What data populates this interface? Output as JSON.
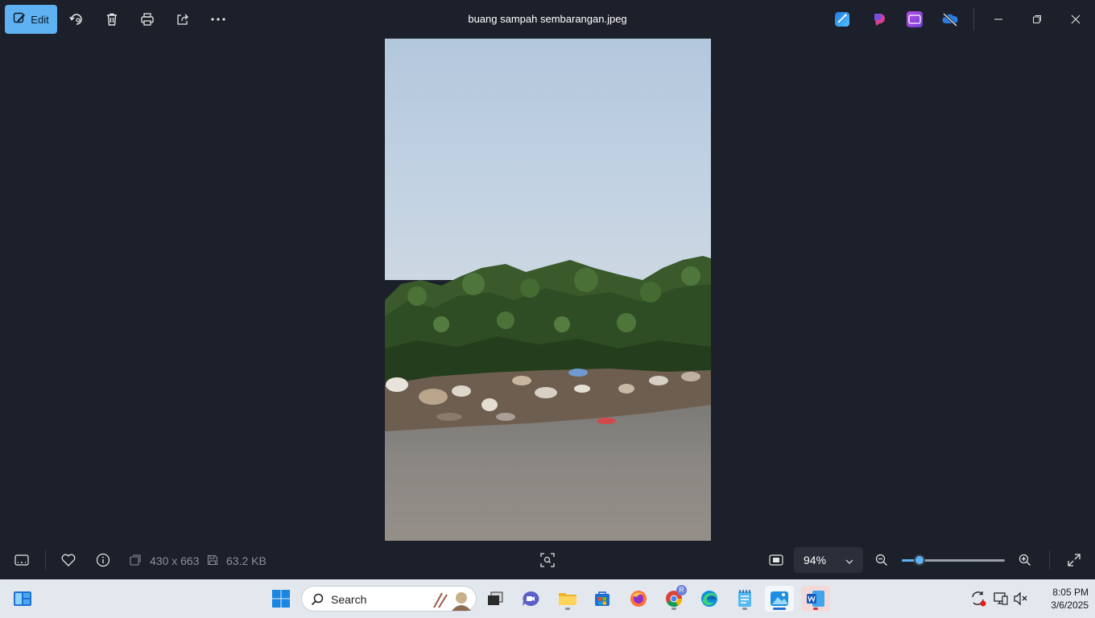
{
  "toolbar": {
    "edit_label": "Edit",
    "title": "buang sampah sembarangan.jpeg"
  },
  "info_bar": {
    "dimensions": "430 x 663",
    "file_size": "63.2 KB",
    "zoom_level": "94%",
    "zoom_slider_fraction": 0.17
  },
  "taskbar": {
    "search_placeholder": "Search",
    "chrome_profile_badge": "R",
    "time": "8:05 PM",
    "date": "3/6/2025"
  },
  "colors": {
    "accent": "#5fb2f2",
    "background": "#1c202a",
    "taskbar": "#e3e8ef"
  }
}
